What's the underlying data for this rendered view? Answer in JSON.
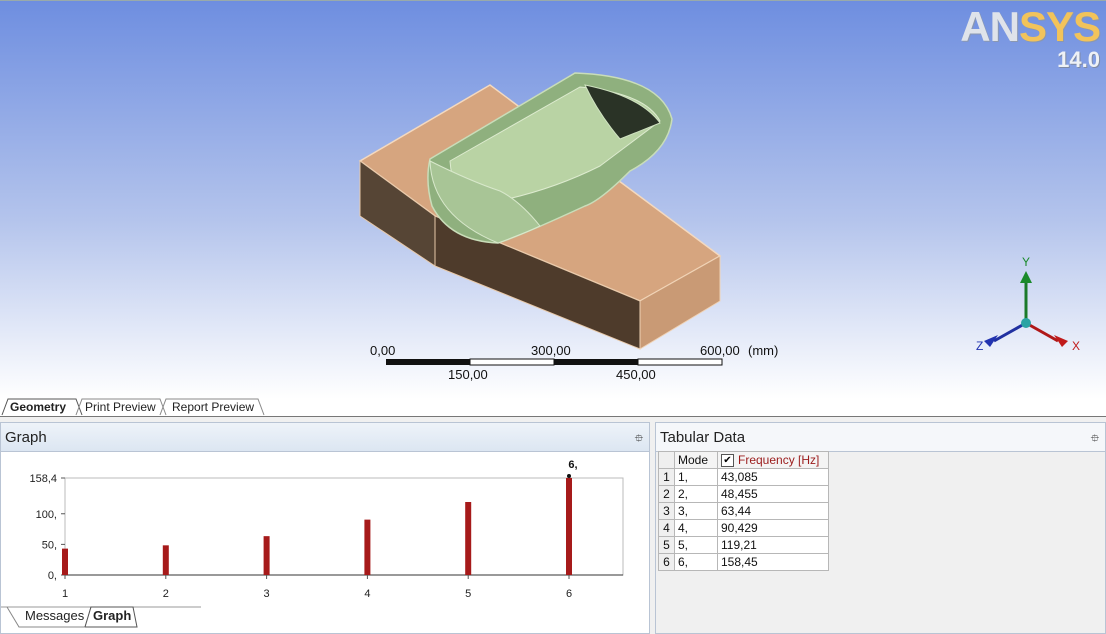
{
  "logo": {
    "brand_a": "AN",
    "brand_b": "SYS",
    "version": "14.0"
  },
  "scale_bar": {
    "unit": "(mm)",
    "labels_top": [
      "0,00",
      "300,00",
      "600,00"
    ],
    "labels_bottom": [
      "150,00",
      "450,00"
    ]
  },
  "triad": {
    "x": "X",
    "y": "Y",
    "z": "Z"
  },
  "view_tabs": [
    "Geometry",
    "Print Preview",
    "Report Preview"
  ],
  "graph": {
    "title": "Graph",
    "pin": "⯐",
    "tabs": [
      "Messages",
      "Graph"
    ]
  },
  "chart_data": {
    "type": "bar",
    "categories": [
      "1",
      "2",
      "3",
      "4",
      "5",
      "6"
    ],
    "values": [
      43.085,
      48.455,
      63.44,
      90.429,
      119.21,
      158.45
    ],
    "ytick_labels": [
      "158,4",
      "100,",
      "50,",
      "0,"
    ],
    "ytick_values": [
      158.4,
      100,
      50,
      0
    ],
    "ylim": [
      0,
      158.4
    ],
    "annotation": "6,",
    "bar_color": "#a61a1a"
  },
  "tabular": {
    "title": "Tabular Data",
    "pin": "⯐",
    "headers": [
      "Mode",
      "Frequency [Hz]"
    ],
    "rows": [
      [
        "1",
        "1,",
        "43,085"
      ],
      [
        "2",
        "2,",
        "48,455"
      ],
      [
        "3",
        "3,",
        "63,44"
      ],
      [
        "4",
        "4,",
        "90,429"
      ],
      [
        "5",
        "5,",
        "119,21"
      ],
      [
        "6",
        "6,",
        "158,45"
      ]
    ]
  }
}
